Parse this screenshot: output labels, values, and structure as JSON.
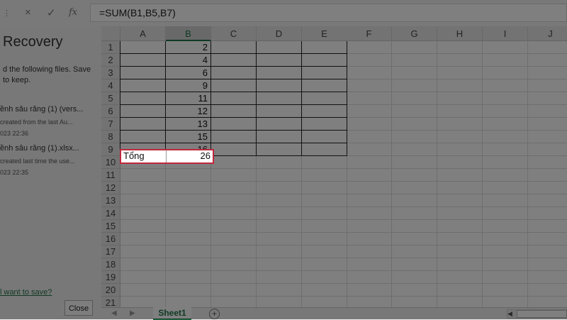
{
  "formula_bar": {
    "handle": "⋮",
    "cancel_icon": "×",
    "enter_icon": "✓",
    "fx_label": "fx",
    "formula": "=SUM(B1,B5,B7)"
  },
  "recovery": {
    "title": "Recovery",
    "line1": "d the following files.  Save",
    "line2": "to keep.",
    "files": [
      {
        "name": "ềnh sâu răng (1) (vers...",
        "desc": "created from the last Au...",
        "date": "023 22:36"
      },
      {
        "name": "ềnh sâu răng (1).xlsx...",
        "desc": "created last time the use...",
        "date": "023 22:35"
      }
    ],
    "link": "l want to save?",
    "close_label": "Close"
  },
  "grid": {
    "columns": [
      "A",
      "B",
      "C",
      "D",
      "E",
      "F",
      "G",
      "H",
      "I",
      "J"
    ],
    "selected_column": "B",
    "rows": [
      "1",
      "2",
      "3",
      "4",
      "5",
      "6",
      "7",
      "8",
      "9",
      "10",
      "11",
      "12",
      "13",
      "14",
      "15",
      "16",
      "17",
      "18",
      "19",
      "20",
      "21",
      "22"
    ],
    "b_values": [
      "2",
      "4",
      "6",
      "9",
      "11",
      "12",
      "13",
      "15",
      "16"
    ],
    "total_label": "Tổng",
    "total_value": "26"
  },
  "tabs": {
    "prev_icon": "◀",
    "next_icon": "▶",
    "sheet_name": "Sheet1",
    "add_icon": "+",
    "scroll_left_icon": "◀"
  },
  "colors": {
    "accent": "#217346",
    "highlight_border": "#c0283d"
  }
}
